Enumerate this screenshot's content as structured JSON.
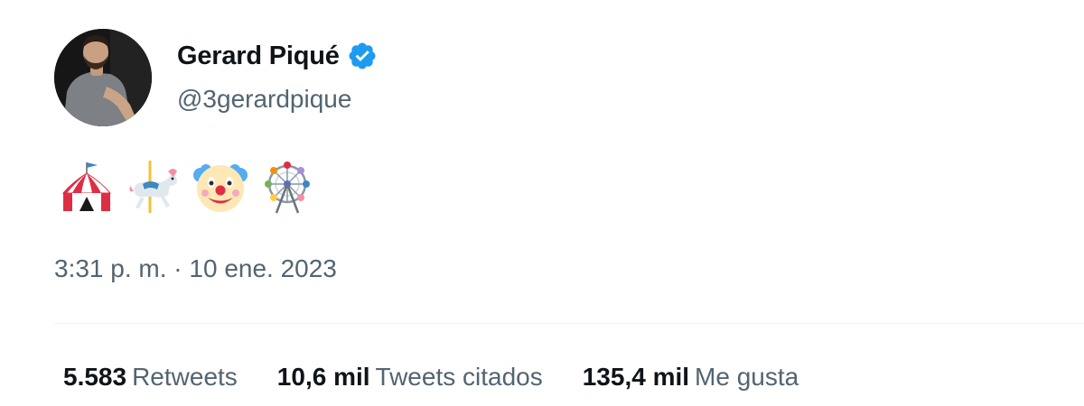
{
  "author": {
    "name": "Gerard Piqué",
    "handle": "@3gerardpique",
    "verified": true
  },
  "tweet": {
    "emojis": [
      "circus-tent",
      "carousel-horse",
      "clown-face",
      "ferris-wheel"
    ]
  },
  "timestamp": "3:31 p. m. · 10 ene. 2023",
  "stats": [
    {
      "count": "5.583",
      "label": "Retweets"
    },
    {
      "count": "10,6 mil",
      "label": "Tweets citados"
    },
    {
      "count": "135,4 mil",
      "label": "Me gusta"
    }
  ],
  "colors": {
    "text": "#0f1419",
    "secondary": "#536471",
    "verified_badge": "#1d9bf0",
    "divider": "#eff3f4"
  }
}
